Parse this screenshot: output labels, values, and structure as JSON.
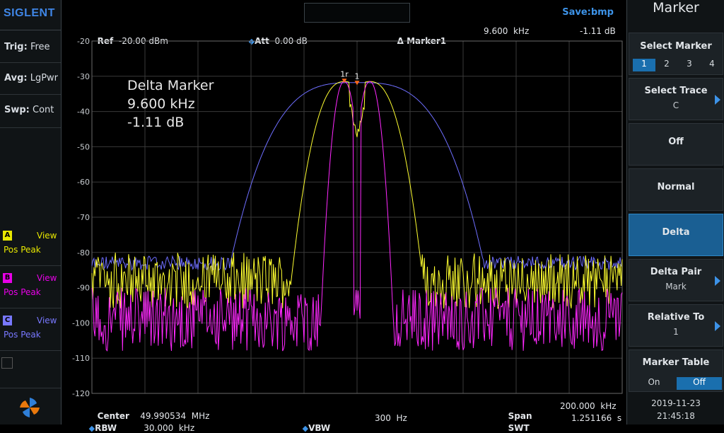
{
  "left": {
    "logo": "SIGLENT",
    "trig_label": "Trig:",
    "trig_value": "Free",
    "avg_label": "Avg:",
    "avg_value": "LgPwr",
    "swp_label": "Swp:",
    "swp_value": "Cont",
    "traces": [
      {
        "id": "A",
        "view": "View",
        "detector": "Pos Peak",
        "color": "#e8e800"
      },
      {
        "id": "B",
        "view": "View",
        "detector": "Pos Peak",
        "color": "#e800e8"
      },
      {
        "id": "C",
        "view": "View",
        "detector": "Pos Peak",
        "color": "#7878ff"
      }
    ]
  },
  "top": {
    "save": "Save:bmp"
  },
  "info": {
    "ref_label": "Ref",
    "ref_value": "-20.00 dBm",
    "att_label": "Att",
    "att_value": "0.00 dB",
    "marker_label": "Δ Marker1",
    "marker_freq": "9.600  kHz",
    "marker_level": "-1.11 dB"
  },
  "overlay": {
    "title": "Delta Marker",
    "freq": "9.600  kHz",
    "level": "-1.11 dB"
  },
  "graph": {
    "y_ticks": [
      "-20",
      "-30",
      "-40",
      "-50",
      "-60",
      "-70",
      "-80",
      "-90",
      "-100",
      "-110",
      "-120"
    ],
    "marker_ref_label": "1r",
    "marker_label": "1",
    "colors": {
      "trace_a": "#ffff30",
      "trace_b": "#ff28ff",
      "trace_c": "#6e6eff",
      "grid": "#3a3a3a",
      "marker": "#ff6a1a"
    }
  },
  "bottom": {
    "center_label": "Center",
    "center_value": "49.990534  MHz",
    "rbw_label": "RBW",
    "rbw_value": "30.000  kHz",
    "vbw_label": "VBW",
    "vbw_value": "300  Hz",
    "span_label": "Span",
    "span_value": "200.000  kHz",
    "swt_label": "SWT",
    "swt_value": "1.251166  s"
  },
  "menu": {
    "title": "Marker",
    "select_marker": "Select Marker",
    "marker_numbers": [
      "1",
      "2",
      "3",
      "4"
    ],
    "select_trace": "Select Trace",
    "select_trace_value": "C",
    "off": "Off",
    "normal": "Normal",
    "delta": "Delta",
    "delta_pair": "Delta Pair",
    "delta_pair_value": "Mark",
    "relative_to": "Relative To",
    "relative_to_value": "1",
    "marker_table": "Marker Table",
    "table_on": "On",
    "table_off": "Off",
    "date": "2019-11-23",
    "time": "21:45:18"
  }
}
